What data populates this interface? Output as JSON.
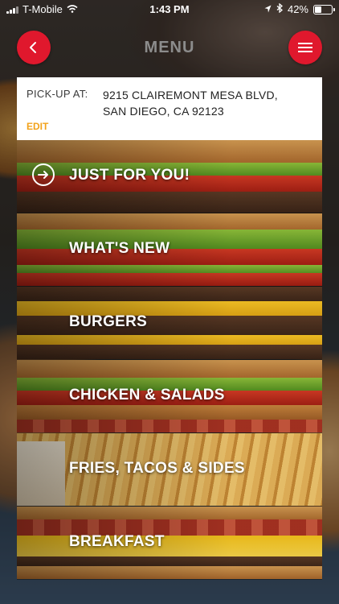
{
  "status_bar": {
    "carrier": "T-Mobile",
    "time": "1:43 PM",
    "battery": "42%",
    "battery_level": 0.42
  },
  "header": {
    "title": "MENU",
    "back_icon": "chevron-left-icon",
    "menu_icon": "hamburger-icon",
    "accent_color": "#e0182d"
  },
  "pickup": {
    "label": "PICK-UP AT:",
    "address_line1": "9215 CLAIREMONT MESA BLVD,",
    "address_line2": "SAN DIEGO, CA 92123",
    "edit_label": "EDIT",
    "edit_color": "#f2a21a"
  },
  "categories": [
    {
      "label": "JUST FOR  YOU!",
      "icon": "arrow-circle-right-icon"
    },
    {
      "label": "WHAT'S NEW"
    },
    {
      "label": "BURGERS"
    },
    {
      "label": "CHICKEN & SALADS"
    },
    {
      "label": "FRIES, TACOS & SIDES"
    },
    {
      "label": "BREAKFAST"
    }
  ]
}
